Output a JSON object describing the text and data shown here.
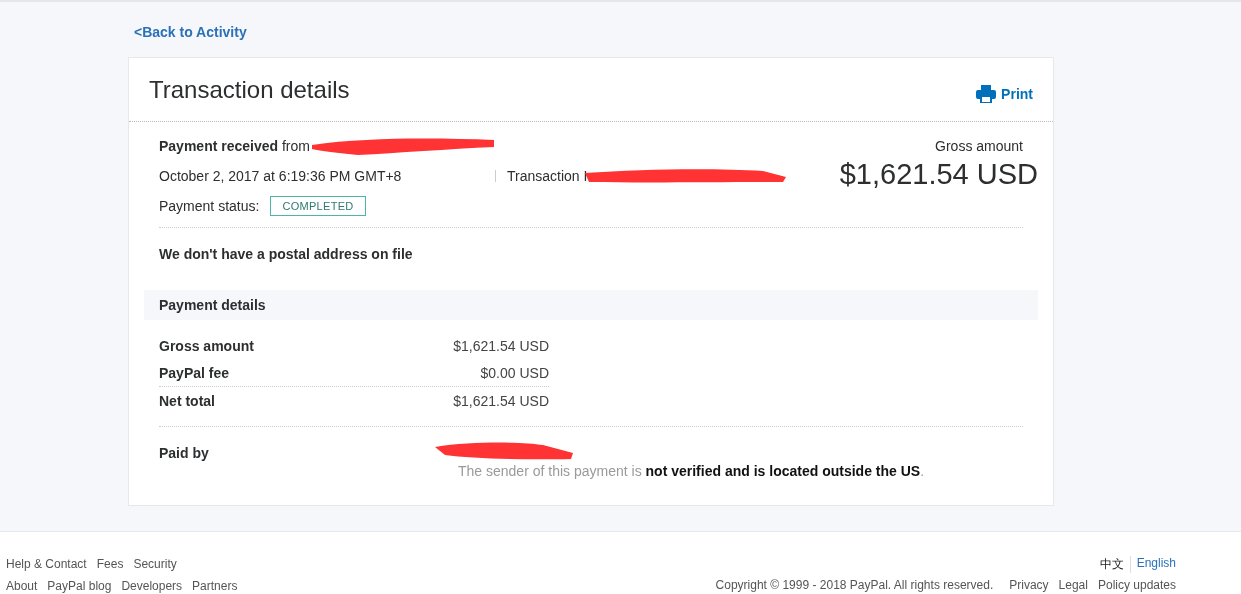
{
  "back_link": "<Back to Activity",
  "card": {
    "title": "Transaction details",
    "print_button": "Print",
    "summary": {
      "received": "**Payment received** from",
      "date": "October 2, 2017 at 6:19:36 PM GMT+8",
      "transaction_label": "Transaction I",
      "status_label": "Payment status:",
      "status_badge": "COMPLETED",
      "gross_label": "Gross amount",
      "gross_value": "$1,621.54 USD"
    },
    "address_note": "We don't have a postal address on file",
    "payment_details": {
      "heading": "Payment details",
      "rows": [
        {
          "label": "Gross amount",
          "value": "$1,621.54 USD"
        },
        {
          "label": "PayPal fee",
          "value": "$0.00 USD"
        },
        {
          "label": "Net total",
          "value": "$1,621.54 USD"
        }
      ]
    },
    "paid_by": {
      "label": "Paid by",
      "note": "The sender of this payment is **not verified and is located outside the US**."
    }
  },
  "footer": {
    "links": [
      [
        "Help & Contact",
        "Fees",
        "Security"
      ],
      [
        "About",
        "PayPal blog",
        "Developers",
        "Partners"
      ]
    ],
    "languages": [
      {
        "label": "中文",
        "selected": true
      },
      {
        "label": "English",
        "selected": false
      }
    ],
    "copyright": "Copyright © 1999 - 2018 PayPal. All rights reserved.",
    "legal_links": [
      "Privacy",
      "Legal",
      "Policy updates"
    ]
  }
}
